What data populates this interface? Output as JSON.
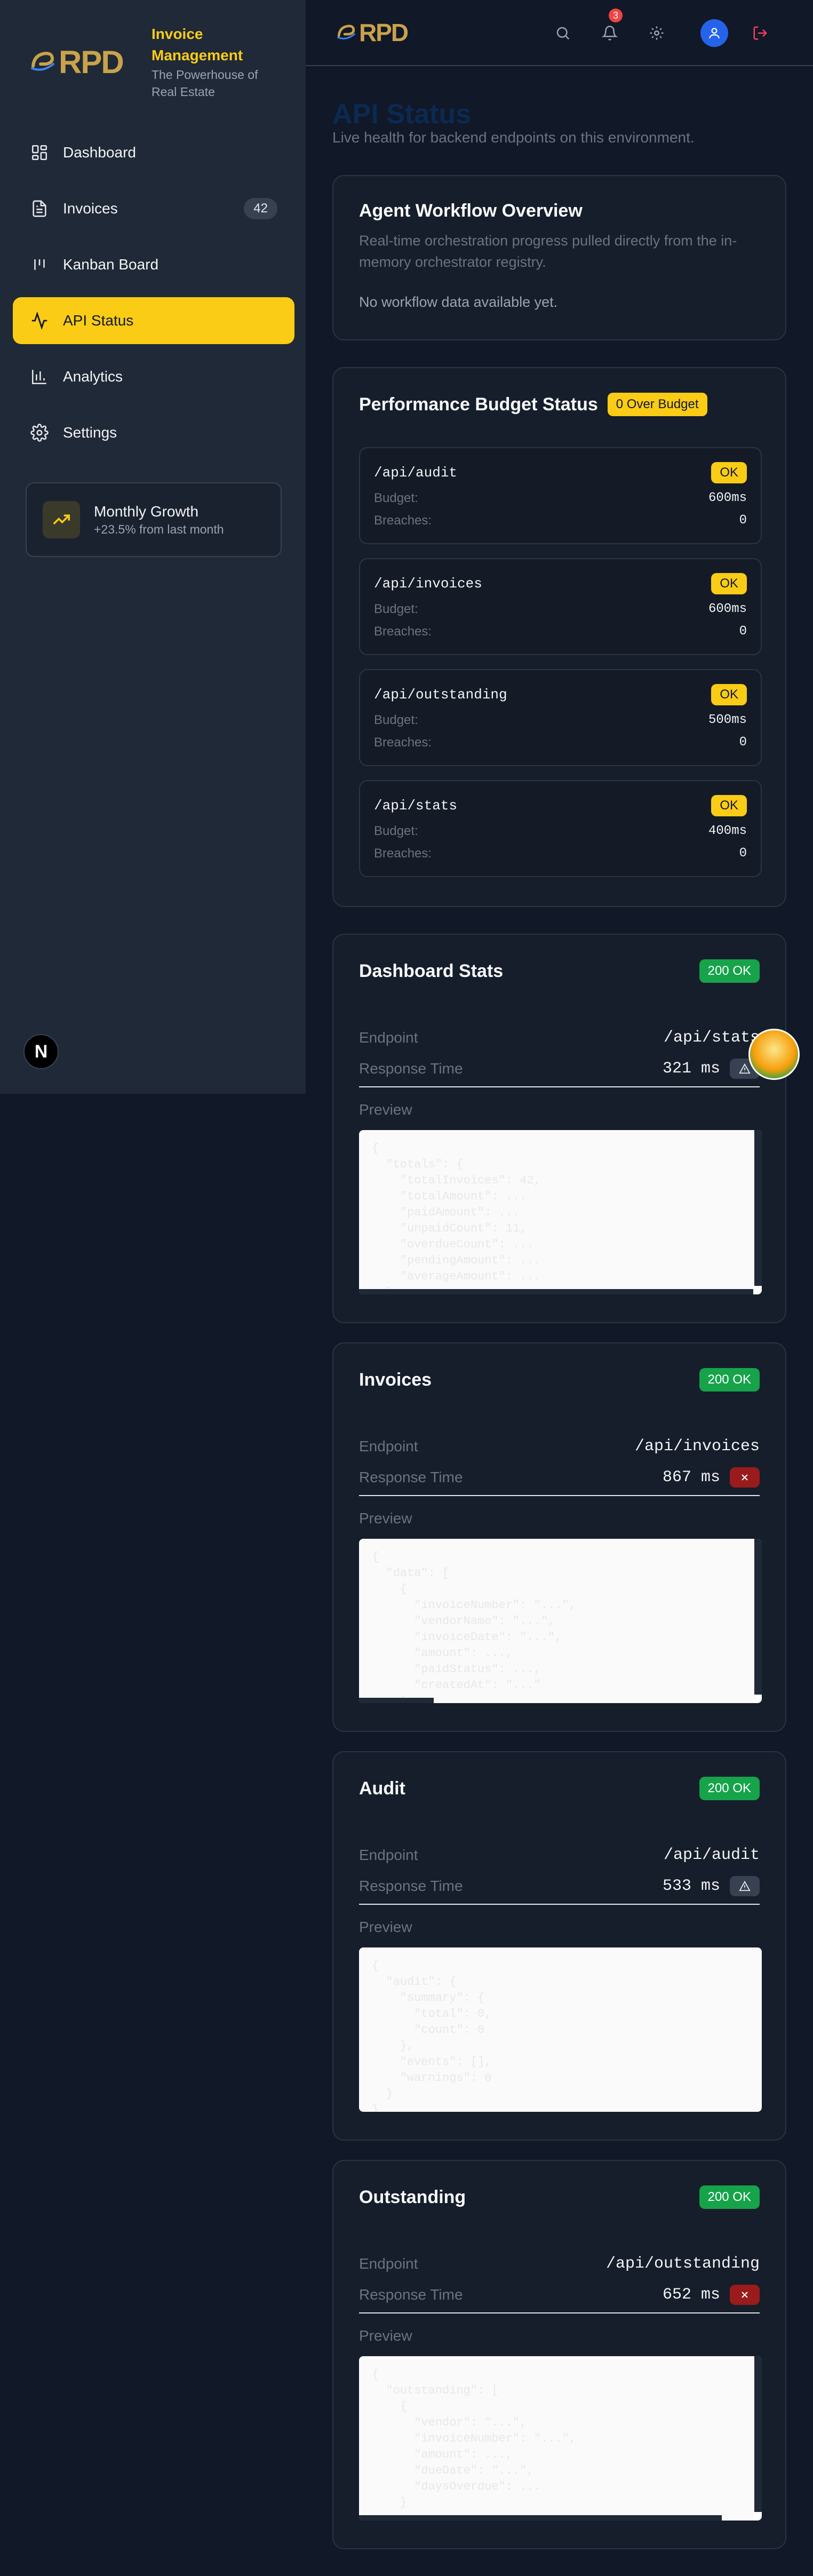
{
  "brand": {
    "logo_text": "RPD",
    "title": "Invoice Management",
    "subtitle": "The Powerhouse of Real Estate"
  },
  "sidebar": {
    "items": [
      {
        "label": "Dashboard",
        "icon": "dashboard-icon"
      },
      {
        "label": "Invoices",
        "icon": "document-icon",
        "badge": "42"
      },
      {
        "label": "Kanban Board",
        "icon": "kanban-icon"
      },
      {
        "label": "API Status",
        "icon": "activity-icon",
        "active": true
      },
      {
        "label": "Analytics",
        "icon": "bar-chart-icon"
      },
      {
        "label": "Settings",
        "icon": "gear-icon"
      }
    ],
    "growth": {
      "title": "Monthly Growth",
      "subtitle": "+23.5% from last month"
    },
    "dev_badge": "N"
  },
  "topbar": {
    "logo_text": "RPD",
    "notification_count": "3",
    "icons": [
      "search-icon",
      "bell-icon",
      "gear-icon",
      "user-icon",
      "logout-icon"
    ]
  },
  "page": {
    "title": "API Status",
    "subtitle": "Live health for backend endpoints on this environment."
  },
  "agent": {
    "title": "Agent Workflow Overview",
    "description": "Real-time orchestration progress pulled directly from the in-memory orchestrator registry.",
    "empty": "No workflow data available yet."
  },
  "budget": {
    "title": "Performance Budget Status",
    "over_label": "0 Over Budget",
    "budget_label": "Budget:",
    "breaches_label": "Breaches:",
    "items": [
      {
        "endpoint": "/api/audit",
        "status": "OK",
        "budget": "600ms",
        "breaches": "0"
      },
      {
        "endpoint": "/api/invoices",
        "status": "OK",
        "budget": "600ms",
        "breaches": "0"
      },
      {
        "endpoint": "/api/outstanding",
        "status": "OK",
        "budget": "500ms",
        "breaches": "0"
      },
      {
        "endpoint": "/api/stats",
        "status": "OK",
        "budget": "400ms",
        "breaches": "0"
      }
    ]
  },
  "endpoint_labels": {
    "endpoint": "Endpoint",
    "response_time": "Response Time",
    "preview": "Preview"
  },
  "endpoints": [
    {
      "title": "Dashboard Stats",
      "status": "200 OK",
      "endpoint": "/api/stats",
      "response_time": "321 ms",
      "rt_state": "warn",
      "preview": "{\n  \"totals\": {\n    \"totalInvoices\": 42,\n    \"totalAmount\": ...\n    \"paidAmount\": ...\n    \"unpaidCount\": 11,\n    \"overdueCount\": ...\n    \"pendingAmount\": ...\n    \"averageAmount\": ...\n  }"
    },
    {
      "title": "Invoices",
      "status": "200 OK",
      "endpoint": "/api/invoices",
      "response_time": "867 ms",
      "rt_state": "err",
      "preview": "{\n  \"data\": [\n    {\n      \"invoiceNumber\": \"...\",\n      \"vendorName\": \"...\",\n      \"invoiceDate\": \"...\",\n      \"amount\": ...,\n      \"paidStatus\": ...,\n      \"createdAt\": \"...\"\n    }"
    },
    {
      "title": "Audit",
      "status": "200 OK",
      "endpoint": "/api/audit",
      "response_time": "533 ms",
      "rt_state": "warn",
      "preview": "{\n  \"audit\": {\n    \"summary\": {\n      \"total\": 0,\n      \"count\": 0\n    },\n    \"events\": [],\n    \"warnings\": 0\n  }\n}"
    },
    {
      "title": "Outstanding",
      "status": "200 OK",
      "endpoint": "/api/outstanding",
      "response_time": "652 ms",
      "rt_state": "err",
      "preview": "{\n  \"outstanding\": [\n    {\n      \"vendor\": \"...\",\n      \"invoiceNumber\": \"...\",\n      \"amount\": ...,\n      \"dueDate\": \"...\",\n      \"daysOverdue\": ...\n    }"
    }
  ]
}
